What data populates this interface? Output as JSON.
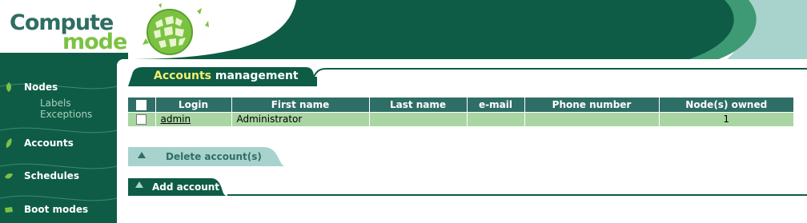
{
  "logo": {
    "line1": "Compute",
    "line2": "mode"
  },
  "colors": {
    "brand_dark": "#0e5c46",
    "brand_mid": "#3d9a74",
    "brand_light": "#a8d3cd",
    "header_table": "#2f6e66",
    "row_bg": "#a8d5a2",
    "logo_green": "#7cc242",
    "title_highlight": "#f4f06a"
  },
  "sidebar": {
    "items": [
      {
        "label": "Nodes",
        "icon": "leaf-icon",
        "subitems": [
          "Labels",
          "Exceptions"
        ]
      },
      {
        "label": "Accounts",
        "icon": "leaf-icon"
      },
      {
        "label": "Schedules",
        "icon": "leaf-icon"
      },
      {
        "label": "Boot modes",
        "icon": "leaf-icon"
      }
    ]
  },
  "page": {
    "title_highlight": "Accounts",
    "title_rest": " management"
  },
  "table": {
    "columns": [
      "Login",
      "First name",
      "Last name",
      "e-mail",
      "Phone number",
      "Node(s) owned"
    ],
    "rows": [
      {
        "login": "admin",
        "first_name": "Administrator",
        "last_name": "",
        "email": "",
        "phone": "",
        "nodes_owned": "1",
        "checked": false
      }
    ]
  },
  "actions": {
    "delete_label": "Delete account(s)",
    "add_label": "Add account"
  }
}
